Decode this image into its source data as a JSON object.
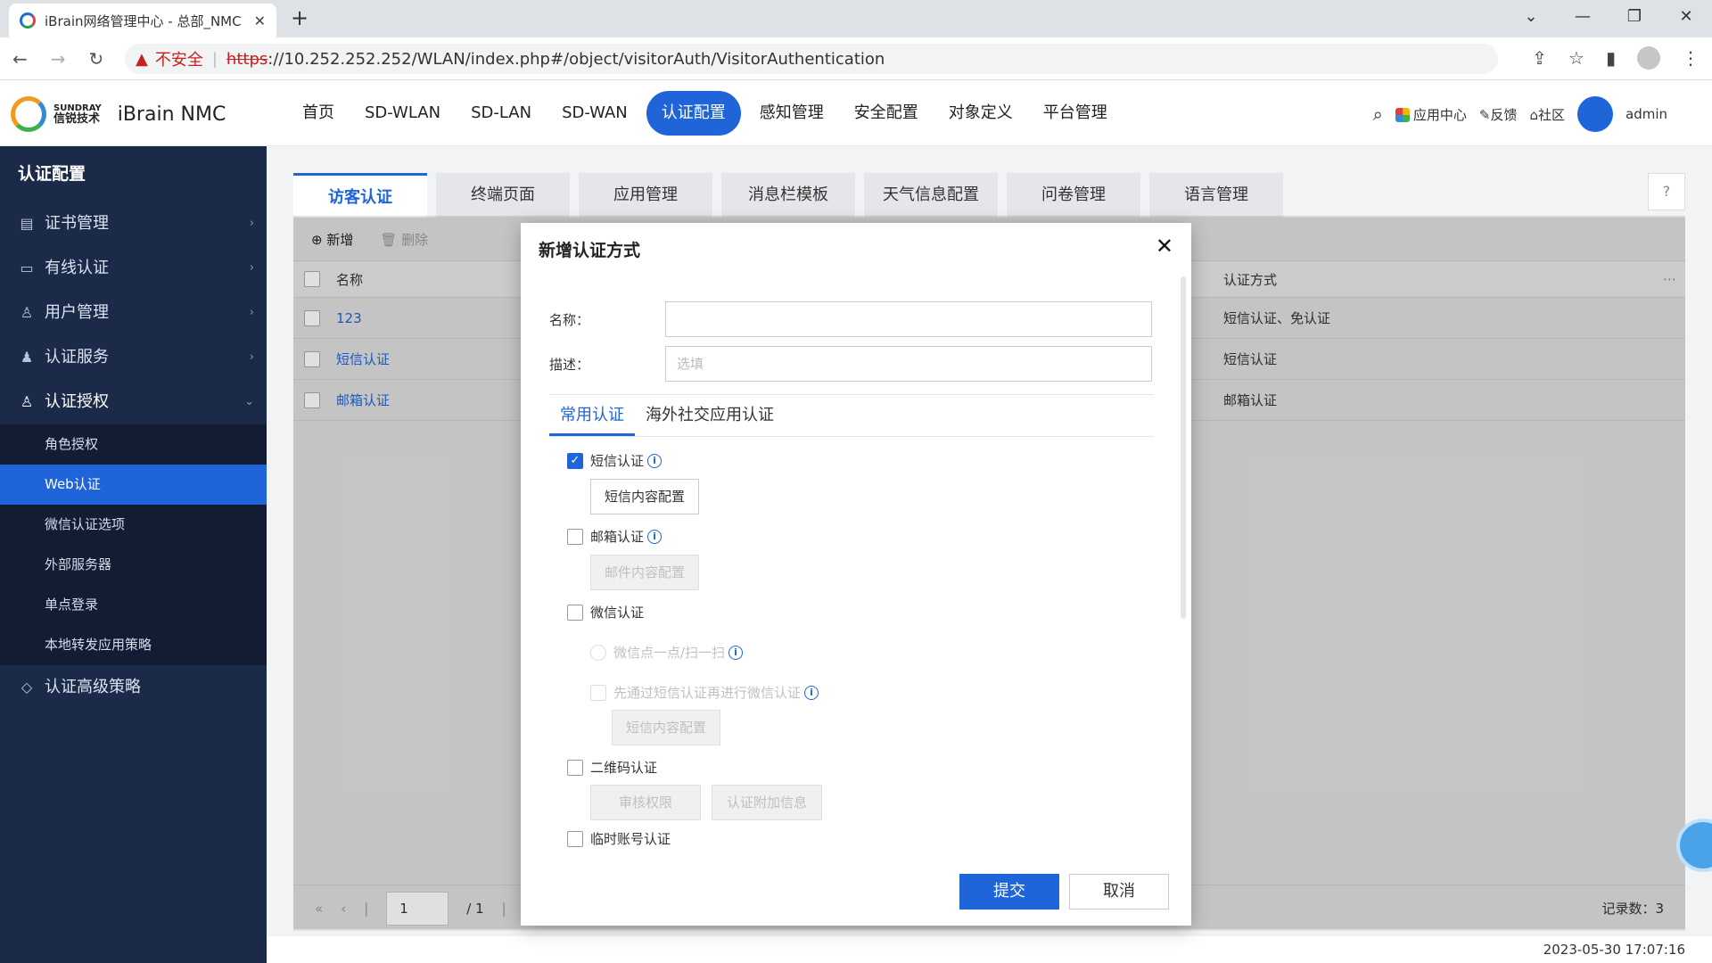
{
  "browser": {
    "tab_title": "iBrain网络管理中心 - 总部_NMC",
    "not_secure": "不安全",
    "url_scheme": "https",
    "url_rest": "://10.252.252.252/WLAN/index.php#/object/visitorAuth/VisitorAuthentication"
  },
  "header": {
    "brand_en": "SUNDRAY",
    "brand_cn": "信锐技术",
    "product": "iBrain NMC",
    "nav": [
      "首页",
      "SD-WLAN",
      "SD-LAN",
      "SD-WAN",
      "认证配置",
      "感知管理",
      "安全配置",
      "对象定义",
      "平台管理"
    ],
    "app_center": "应用中心",
    "feedback": "反馈",
    "community": "社区",
    "user": "admin"
  },
  "sidebar": {
    "title": "认证配置",
    "items": [
      {
        "label": "证书管理"
      },
      {
        "label": "有线认证"
      },
      {
        "label": "用户管理"
      },
      {
        "label": "认证服务"
      },
      {
        "label": "认证授权"
      }
    ],
    "sub_items": [
      "角色授权",
      "Web认证",
      "微信认证选项",
      "外部服务器",
      "单点登录",
      "本地转发应用策略"
    ],
    "bottom_item": "认证高级策略"
  },
  "content": {
    "tabs": [
      "访客认证",
      "终端页面",
      "应用管理",
      "消息栏模板",
      "天气信息配置",
      "问卷管理",
      "语言管理"
    ],
    "toolbar": {
      "add": "新增",
      "delete": "删除"
    },
    "columns": {
      "name": "名称",
      "method": "认证方式"
    },
    "rows": [
      {
        "name": "123",
        "method": "短信认证、免认证"
      },
      {
        "name": "短信认证",
        "method": "短信认证"
      },
      {
        "name": "邮箱认证",
        "method": "邮箱认证"
      }
    ],
    "pager": {
      "page": "1",
      "total": "/ 1",
      "records": "记录数：3"
    },
    "timestamp": "2023-05-30 17:07:16"
  },
  "modal": {
    "title": "新增认证方式",
    "name_label": "名称：",
    "desc_label": "描述：",
    "desc_placeholder": "选填",
    "tabs": [
      "常用认证",
      "海外社交应用认证"
    ],
    "sms": {
      "label": "短信认证",
      "checked": true,
      "button": "短信内容配置"
    },
    "email": {
      "label": "邮箱认证",
      "checked": false,
      "button": "邮件内容配置"
    },
    "wechat": {
      "label": "微信认证",
      "checked": false,
      "opt1": "微信点一点/扫一扫",
      "opt2": "先通过短信认证再进行微信认证",
      "button": "短信内容配置"
    },
    "qrcode": {
      "label": "二维码认证",
      "checked": false,
      "button1": "审核权限",
      "button2": "认证附加信息"
    },
    "temp": {
      "label": "临时账号认证",
      "checked": false
    },
    "submit": "提交",
    "cancel": "取消"
  }
}
